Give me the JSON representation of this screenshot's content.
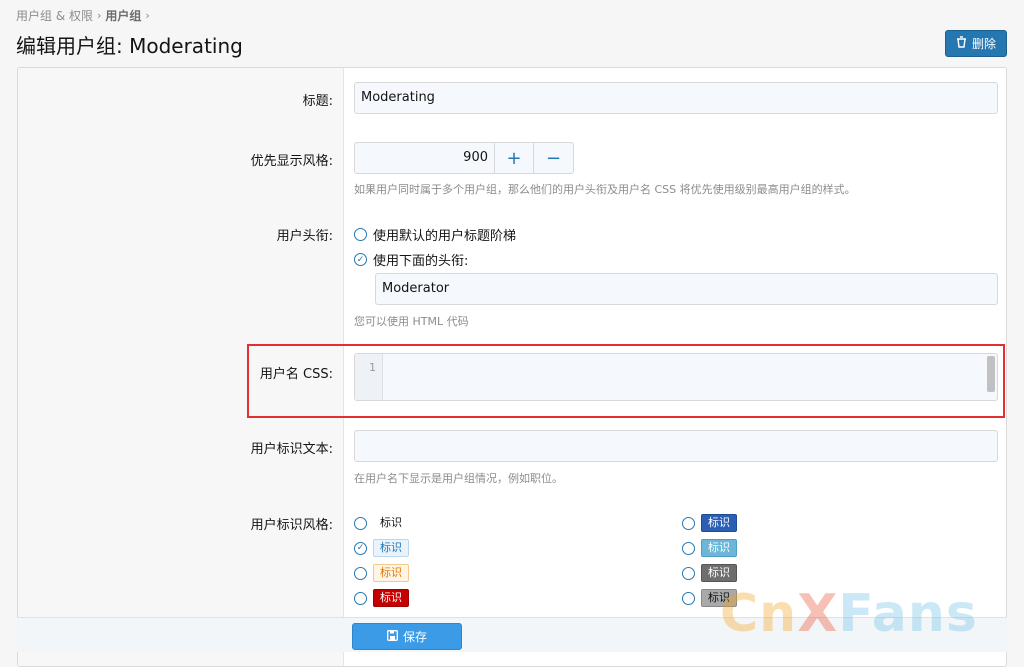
{
  "breadcrumb": {
    "parent": "用户组 & 权限",
    "current": "用户组"
  },
  "page": {
    "title": "编辑用户组: Moderating",
    "delete_label": "删除"
  },
  "fields": {
    "title": {
      "label": "标题:",
      "value": "Moderating"
    },
    "priority": {
      "label": "优先显示风格:",
      "value": "900",
      "plus": "+",
      "minus": "−",
      "hint": "如果用户同时属于多个用户组，那么他们的用户头衔及用户名 CSS 将优先使用级别最高用户组的样式。"
    },
    "user_title": {
      "label": "用户头衔:",
      "option_default": "使用默认的用户标题阶梯",
      "option_custom": "使用下面的头衔:",
      "custom_value": "Moderator",
      "hint": "您可以使用 HTML 代码"
    },
    "username_css": {
      "label": "用户名 CSS:",
      "line_number": "1"
    },
    "banner_text": {
      "label": "用户标识文本:",
      "value": "",
      "hint": "在用户名下显示是用户组情况，例如职位。"
    },
    "banner_style": {
      "label": "用户标识风格:",
      "badge_text": "标识"
    }
  },
  "banner_styles": [
    {
      "col": "left",
      "bg": "transparent",
      "fg": "#141414",
      "border": "transparent",
      "checked": false
    },
    {
      "col": "left",
      "bg": "#e8f3fc",
      "fg": "#2577b1",
      "border": "#bcd8ef",
      "checked": true
    },
    {
      "col": "left",
      "bg": "#fff4e5",
      "fg": "#e07b00",
      "border": "#f5c98a",
      "checked": false
    },
    {
      "col": "left",
      "bg": "#c40000",
      "fg": "#ffffff",
      "border": "#a00000",
      "checked": false
    },
    {
      "col": "right",
      "bg": "#2a5fb4",
      "fg": "#ffffff",
      "border": "#1f4b90",
      "checked": false
    },
    {
      "col": "right",
      "bg": "#6bb6d9",
      "fg": "#ffffff",
      "border": "#4f9fc4",
      "checked": false
    },
    {
      "col": "right",
      "bg": "#6e6e6e",
      "fg": "#ffffff",
      "border": "#555555",
      "checked": false
    },
    {
      "col": "right",
      "bg": "#a9a9a9",
      "fg": "#141414",
      "border": "#8a8a8a",
      "checked": false
    }
  ],
  "footer": {
    "save_label": "保存"
  },
  "watermark": {
    "part1": "Cn",
    "part2": "X",
    "part3": "Fans"
  },
  "colors": {
    "accent": "#2577b1",
    "save": "#3c9be6",
    "highlight": "#e0302f"
  }
}
